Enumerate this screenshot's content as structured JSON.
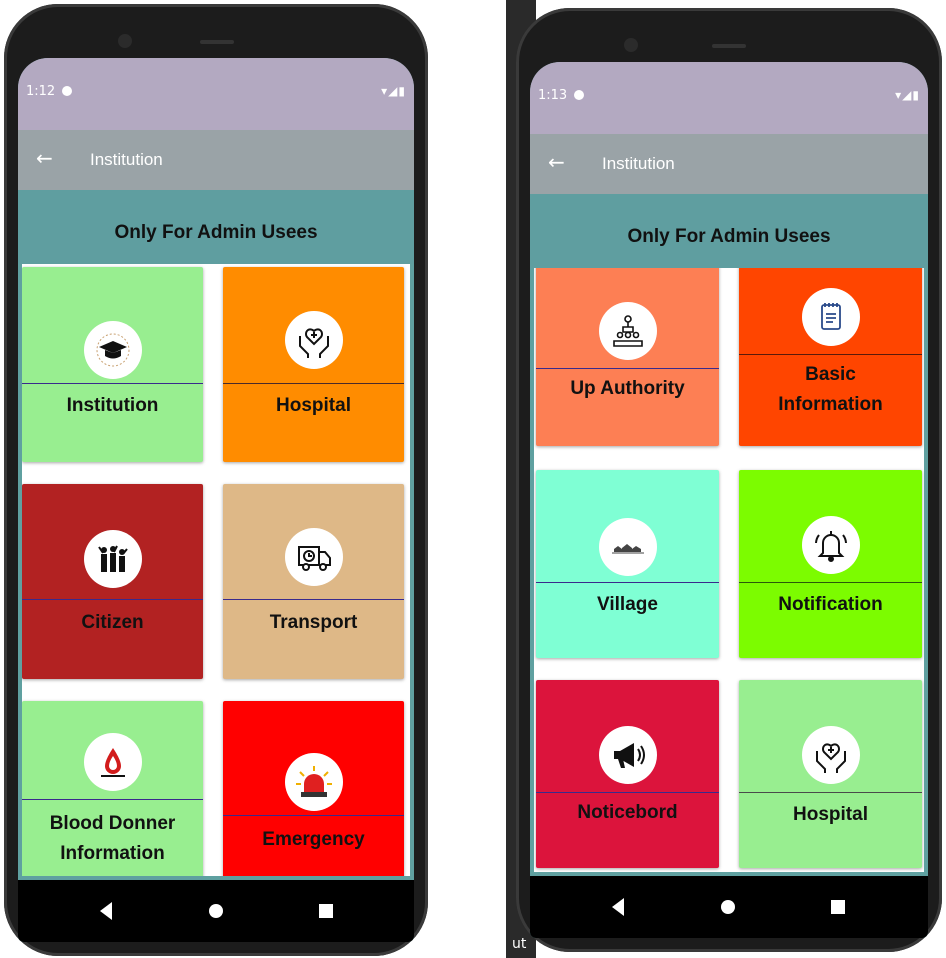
{
  "phones": [
    {
      "status": {
        "time": "1:12",
        "icons": "▾◢▮"
      },
      "appbar": {
        "back": "←",
        "title": "Institution"
      },
      "banner": "Only For Admin Usees",
      "cards": [
        {
          "label": "Institution",
          "bg": "#98ee90",
          "icon": "graduation-cap-icon"
        },
        {
          "label": "Hospital",
          "bg": "#ff8c00",
          "icon": "hands-medical-icon"
        },
        {
          "label": "Citizen",
          "bg": "#b22222",
          "icon": "people-crowd-icon"
        },
        {
          "label": "Transport",
          "bg": "#deb887",
          "icon": "delivery-truck-icon"
        },
        {
          "label": "Blood Donner Information",
          "bg": "#98ee90",
          "icon": "blood-drop-icon"
        },
        {
          "label": "Emergency",
          "bg": "#ff0000",
          "icon": "siren-icon"
        }
      ]
    },
    {
      "status": {
        "time": "1:13",
        "icons": "▾◢▮"
      },
      "appbar": {
        "back": "←",
        "title": "Institution"
      },
      "banner": "Only For Admin Usees",
      "cards": [
        {
          "label": "Up Authority",
          "bg": "#fd7f54",
          "icon": "authority-hierarchy-icon"
        },
        {
          "label": "Basic Information",
          "bg": "#ff4500",
          "icon": "notepad-icon"
        },
        {
          "label": "Village",
          "bg": "#7fffd4",
          "icon": "village-icon"
        },
        {
          "label": "Notification",
          "bg": "#7cfc00",
          "icon": "bell-icon"
        },
        {
          "label": "Noticebord",
          "bg": "#dc143c",
          "icon": "megaphone-icon"
        },
        {
          "label": "Hospital",
          "bg": "#98ee90",
          "icon": "hands-medical-icon"
        }
      ]
    }
  ],
  "background_edge_text": "ut"
}
